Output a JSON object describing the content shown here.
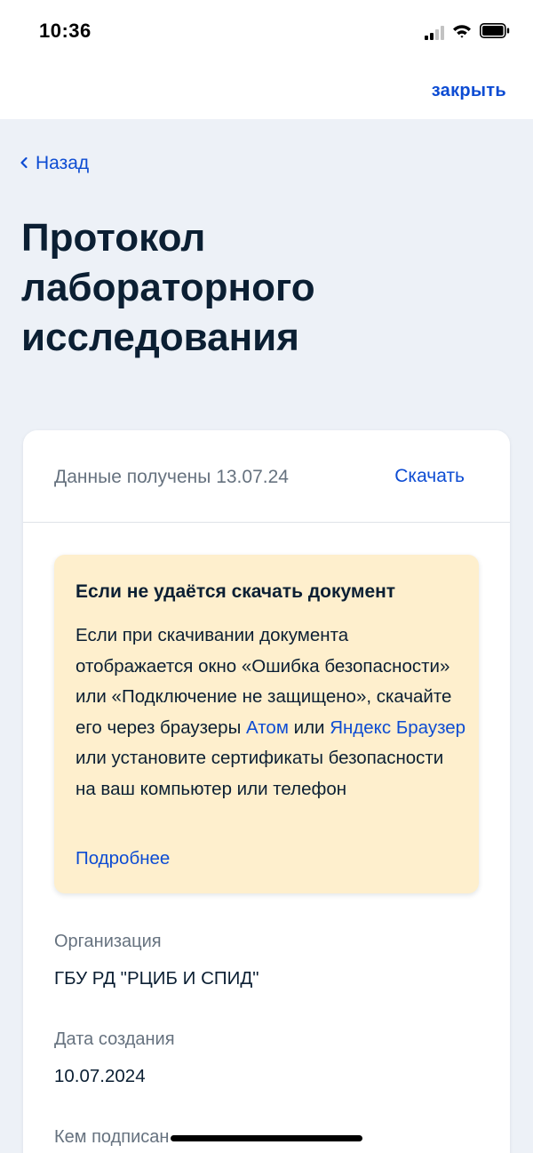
{
  "status_bar": {
    "time": "10:36",
    "icons": [
      "cellular-signal-icon",
      "wifi-icon",
      "battery-icon"
    ]
  },
  "top_bar": {
    "close_label": "закрыть"
  },
  "nav": {
    "back_label": "Назад"
  },
  "page": {
    "title": "Протокол лабораторного исследования"
  },
  "card": {
    "received_text": "Данные получены 13.07.24",
    "download_label": "Скачать",
    "warning": {
      "title": "Если не удаётся скачать документ",
      "text_part1": "Если при скачивании документа отображается окно «Ошибка безопасности» или «Подключение не защищено», скачайте его через браузеры ",
      "link_atom": "Атом",
      "text_part2": " или ",
      "link_yandex": "Яндекс Браузер",
      "text_part3": " или установите сертификаты безопасности на ваш компьютер или телефон",
      "more_label": "Подробнее"
    },
    "fields": [
      {
        "label": "Организация",
        "value": "ГБУ РД \"РЦИБ И СПИД\""
      },
      {
        "label": "Дата создания",
        "value": "10.07.2024"
      },
      {
        "label": "Кем подписан",
        "value": ""
      }
    ]
  },
  "colors": {
    "accent": "#0d4cd3",
    "text": "#0b1f33",
    "muted": "#66727f",
    "background": "#edf1f7",
    "warning_bg": "#feefcd"
  }
}
